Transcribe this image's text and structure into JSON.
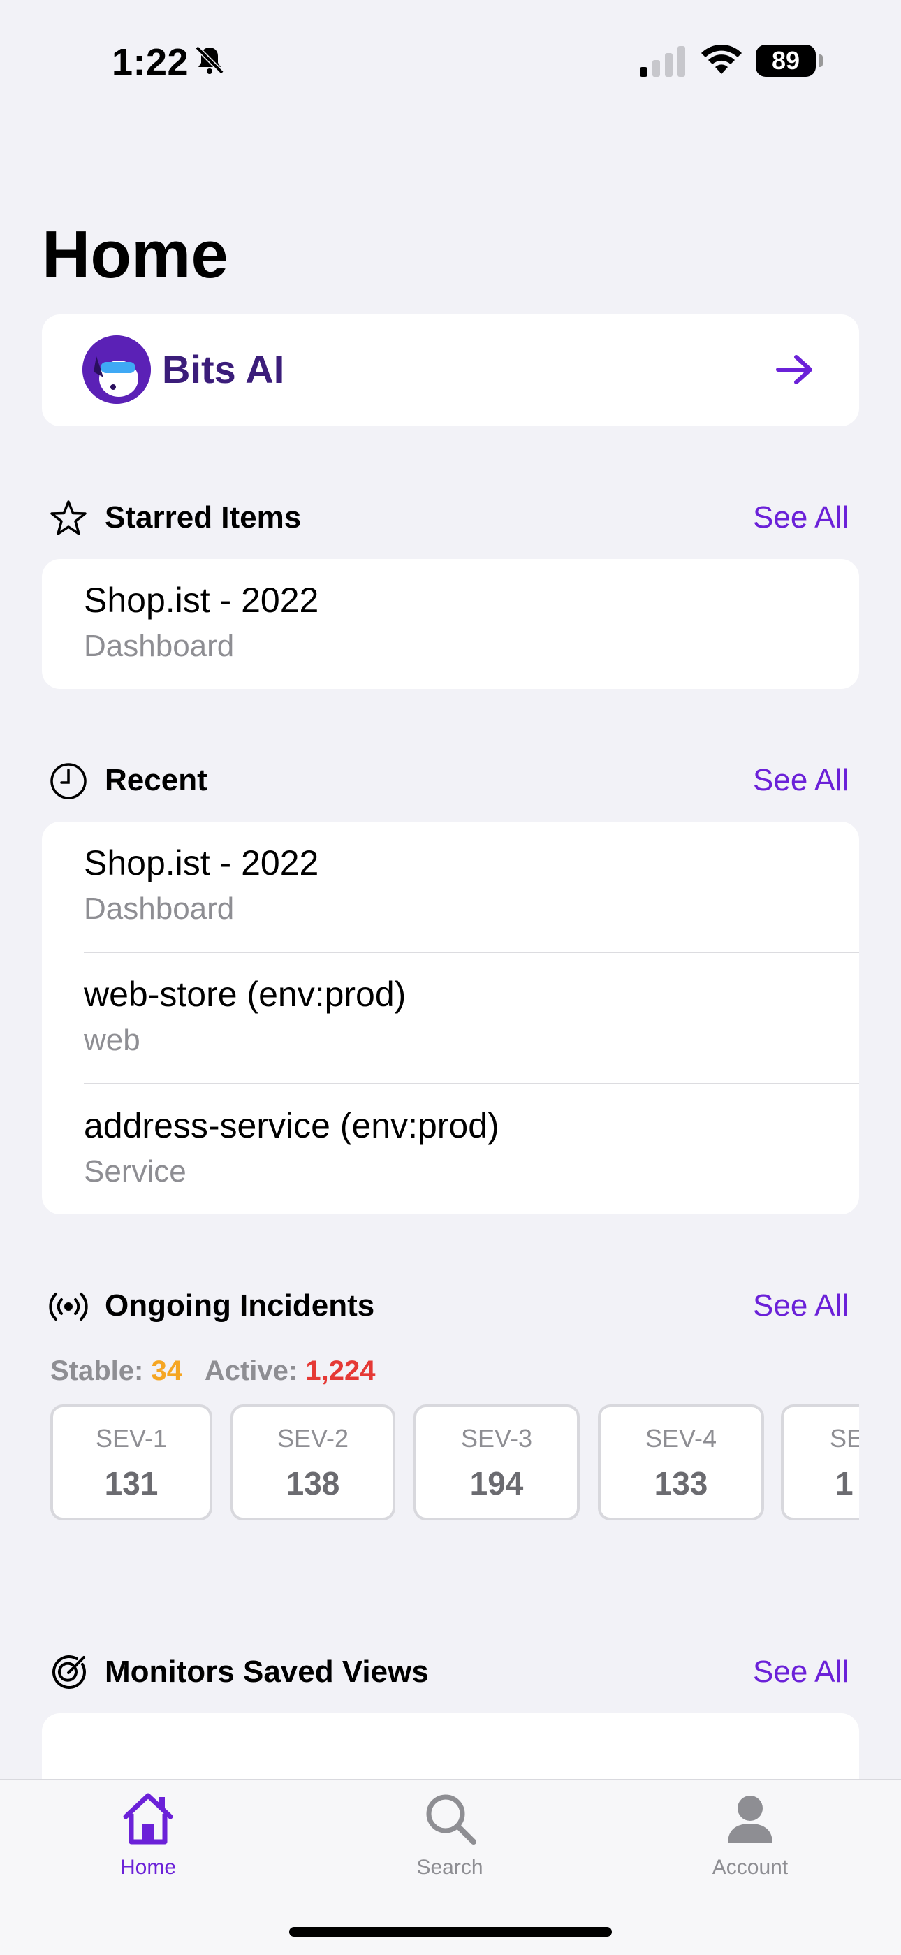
{
  "status": {
    "time": "1:22",
    "battery": "89"
  },
  "page": {
    "title": "Home"
  },
  "bits_ai": {
    "label": "Bits AI"
  },
  "starred": {
    "title": "Starred Items",
    "see_all": "See All",
    "items": [
      {
        "title": "Shop.ist - 2022",
        "subtitle": "Dashboard"
      }
    ]
  },
  "recent": {
    "title": "Recent",
    "see_all": "See All",
    "items": [
      {
        "title": "Shop.ist - 2022",
        "subtitle": "Dashboard"
      },
      {
        "title": "web-store (env:prod)",
        "subtitle": "web"
      },
      {
        "title": "address-service (env:prod)",
        "subtitle": "Service"
      }
    ]
  },
  "incidents": {
    "title": "Ongoing Incidents",
    "see_all": "See All",
    "stable_label": "Stable:",
    "stable_value": "34",
    "active_label": "Active:",
    "active_value": "1,224",
    "severities": [
      {
        "label": "SEV-1",
        "value": "131"
      },
      {
        "label": "SEV-2",
        "value": "138"
      },
      {
        "label": "SEV-3",
        "value": "194"
      },
      {
        "label": "SEV-4",
        "value": "133"
      },
      {
        "label": "SE",
        "value": "1"
      }
    ]
  },
  "monitors": {
    "title": "Monitors Saved Views",
    "see_all": "See All"
  },
  "tabs": [
    {
      "label": "Home",
      "icon": "house-icon",
      "active": true
    },
    {
      "label": "Search",
      "icon": "magnifier-icon",
      "active": false
    },
    {
      "label": "Account",
      "icon": "person-icon",
      "active": false
    }
  ],
  "colors": {
    "accent": "#6b21d8",
    "warning": "#f5a623",
    "danger": "#e53935"
  }
}
